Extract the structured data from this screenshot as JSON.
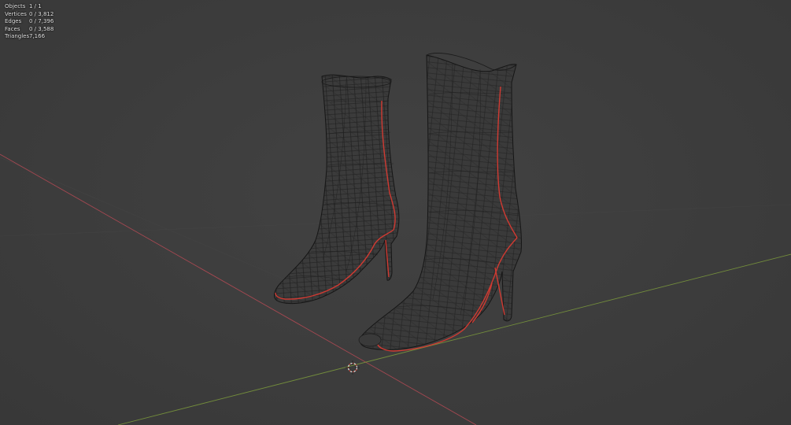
{
  "viewport": {
    "background": "#3d3d3d",
    "wire_color": "#1c1c1c",
    "seam_color": "#d03a32",
    "axis_x_color": "#c2505a",
    "axis_y_color": "#7a9a3a",
    "cursor_icon": "3d-cursor-icon"
  },
  "stats": [
    {
      "label": "Objects",
      "value": "1 / 1"
    },
    {
      "label": "Vertices",
      "value": "0 / 3,812"
    },
    {
      "label": "Edges",
      "value": "0 / 7,396"
    },
    {
      "label": "Faces",
      "value": "0 / 3,588"
    },
    {
      "label": "Triangles",
      "value": "7,166"
    }
  ]
}
